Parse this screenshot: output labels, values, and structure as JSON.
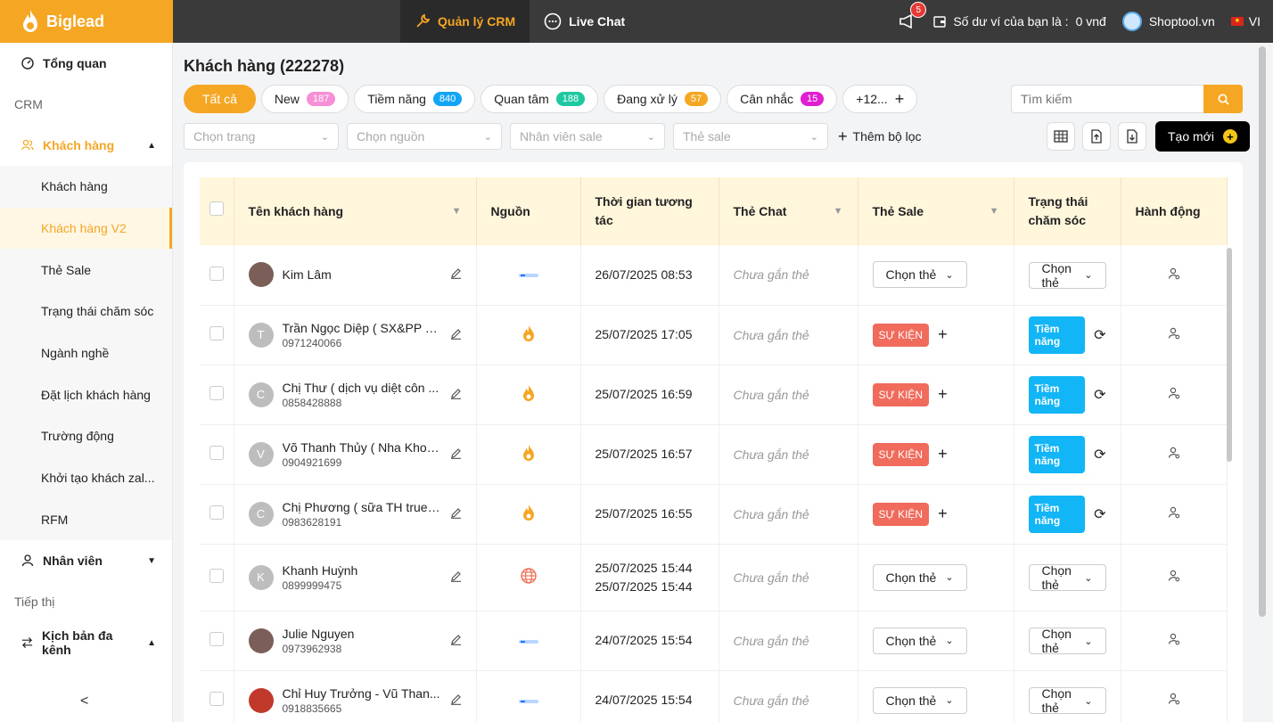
{
  "brand": {
    "name": "Biglead",
    "accent": "#f5a623"
  },
  "topnav": {
    "tabs": [
      {
        "label": "Quản lý CRM",
        "icon": "wrench-icon",
        "active": true
      },
      {
        "label": "Live Chat",
        "icon": "chat-bubble-icon",
        "active": false
      }
    ],
    "notifications": "5",
    "wallet_label": "Số dư ví của bạn là :",
    "wallet_value": "0 vnđ",
    "user": "Shoptool.vn",
    "lang": "VI"
  },
  "sidebar": {
    "overview": "Tổng quan",
    "crm_section": "CRM",
    "customers": "Khách hàng",
    "sub_items": [
      "Khách hàng",
      "Khách hàng V2",
      "Thẻ Sale",
      "Trạng thái chăm sóc",
      "Ngành nghề",
      "Đặt lịch khách hàng",
      "Trường động",
      "Khởi tạo khách zal...",
      "RFM"
    ],
    "staff": "Nhân viên",
    "marketing_section": "Tiếp thị",
    "omni": "Kịch bản đa kênh"
  },
  "page": {
    "title": "Khách hàng (222278)",
    "filters": [
      {
        "label": "Tất cả",
        "count": "",
        "color": ""
      },
      {
        "label": "New",
        "count": "187",
        "color": "#f78fd6"
      },
      {
        "label": "Tiềm năng",
        "count": "840",
        "color": "#12a5f5"
      },
      {
        "label": "Quan tâm",
        "count": "188",
        "color": "#1ec8a0"
      },
      {
        "label": "Đang xử lý",
        "count": "57",
        "color": "#f5a623"
      },
      {
        "label": "Cân nhắc",
        "count": "15",
        "color": "#e020d0"
      },
      {
        "label": "+12...",
        "count": "",
        "color": ""
      }
    ],
    "search_placeholder": "Tìm kiếm",
    "selects": [
      "Chọn trang",
      "Chọn nguồn",
      "Nhân viên sale",
      "Thẻ sale"
    ],
    "add_filter": "Thêm bộ lọc",
    "new_button": "Tạo mới"
  },
  "table": {
    "headers": [
      "Tên khách hàng",
      "Nguồn",
      "Thời gian tương tác",
      "Thẻ Chat",
      "Thẻ Sale",
      "Trạng thái chăm sóc",
      "Hành động"
    ],
    "no_chat_tag": "Chưa gắn thẻ",
    "pick_label": "Chọn thẻ",
    "rows": [
      {
        "name": "Kim Lâm",
        "phone": "",
        "avatar": "",
        "source": "zalo-icon",
        "time": [
          "26/07/2025 08:53"
        ],
        "sale": "pick",
        "status": "pick"
      },
      {
        "name": "Trần Ngọc Diệp ( SX&PP h...",
        "phone": "0971240066",
        "avatar": "T",
        "source": "fire-icon",
        "time": [
          "25/07/2025 17:05"
        ],
        "sale": "SỰ KIỆN",
        "status": "Tiềm năng"
      },
      {
        "name": "Chị Thư ( dịch vụ diệt côn ...",
        "phone": "0858428888",
        "avatar": "C",
        "source": "fire-icon",
        "time": [
          "25/07/2025 16:59"
        ],
        "sale": "SỰ KIỆN",
        "status": "Tiềm năng"
      },
      {
        "name": "Võ Thanh Thủy ( Nha Khoa )",
        "phone": "0904921699",
        "avatar": "V",
        "source": "fire-icon",
        "time": [
          "25/07/2025 16:57"
        ],
        "sale": "SỰ KIỆN",
        "status": "Tiềm năng"
      },
      {
        "name": "Chị Phương ( sữa TH true ...",
        "phone": "0983628191",
        "avatar": "C",
        "source": "fire-icon",
        "time": [
          "25/07/2025 16:55"
        ],
        "sale": "SỰ KIỆN",
        "status": "Tiềm năng"
      },
      {
        "name": "Khanh Huỳnh",
        "phone": "0899999475",
        "avatar": "K",
        "source": "globe-icon",
        "time": [
          "25/07/2025 15:44",
          "25/07/2025 15:44"
        ],
        "sale": "pick",
        "status": "pick"
      },
      {
        "name": "Julie Nguyen",
        "phone": "0973962938",
        "avatar": "",
        "source": "zalo-icon",
        "time": [
          "24/07/2025 15:54"
        ],
        "sale": "pick",
        "status": "pick"
      },
      {
        "name": "Chỉ Huy Trưởng - Vũ Than...",
        "phone": "0918835665",
        "avatar": "",
        "source": "zalo-icon",
        "time": [
          "24/07/2025 15:54"
        ],
        "sale": "pick",
        "status": "pick"
      }
    ]
  }
}
